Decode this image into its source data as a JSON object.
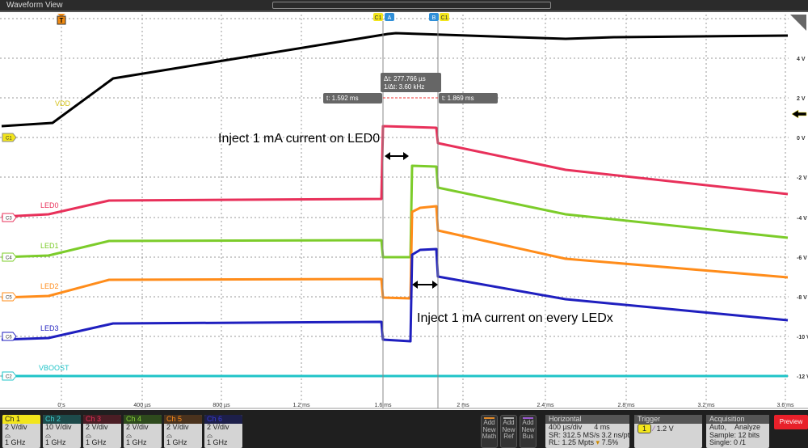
{
  "window": {
    "title": "Waveform View"
  },
  "y_axis_labels": [
    "4 V",
    "2 V",
    "0 V",
    "-2 V",
    "-4 V",
    "-6 V",
    "-8 V",
    "-10 V",
    "-12 V"
  ],
  "x_axis_labels": [
    "0 s",
    "400 µs",
    "800 µs",
    "1.2 ms",
    "1.6 ms",
    "2 ms",
    "2.4 ms",
    "2.8 ms",
    "3.2 ms",
    "3.6 ms"
  ],
  "traces": [
    {
      "label": "VDD",
      "marker": "C1",
      "color": "#000000",
      "label_color": "#d4c21a"
    },
    {
      "label": "LED0",
      "marker": "C3",
      "color": "#e8305a"
    },
    {
      "label": "LED1",
      "marker": "C4",
      "color": "#7ccc2a"
    },
    {
      "label": "LED2",
      "marker": "C5",
      "color": "#ff8c1a"
    },
    {
      "label": "LED3",
      "marker": "C6",
      "color": "#1f1fbf"
    },
    {
      "label": "VBOOST",
      "marker": "C2",
      "color": "#20c4c8"
    }
  ],
  "trigger_marker": "T",
  "cursors": {
    "a_label": "A",
    "b_label": "B",
    "source": "C1",
    "delta": "Δt: 277.766 µs",
    "inv_delta": "1/Δt: 3.60 kHz",
    "a_time": "t: 1.592 ms",
    "b_time": "t: 1.869 ms"
  },
  "annotations": {
    "led0": "Inject 1 mA current on LED0",
    "ledx": "Inject 1 mA current on every LEDx"
  },
  "channels": [
    {
      "name": "Ch 1",
      "scale": "2 V/div",
      "bw": "1 GHz",
      "color": "#f2e51c",
      "text": "#222"
    },
    {
      "name": "Ch 2",
      "scale": "10 V/div",
      "bw": "1 GHz",
      "color": "#1d4a4a",
      "text": "#3fd0d0"
    },
    {
      "name": "Ch 3",
      "scale": "2 V/div",
      "bw": "1 GHz",
      "color": "#4a1d24",
      "text": "#e8305a"
    },
    {
      "name": "Ch 4",
      "scale": "2 V/div",
      "bw": "1 GHz",
      "color": "#2e4a1d",
      "text": "#8ad03a"
    },
    {
      "name": "Ch 5",
      "scale": "2 V/div",
      "bw": "1 GHz",
      "color": "#4a321d",
      "text": "#ff8c1a"
    },
    {
      "name": "Ch 6",
      "scale": "2 V/div",
      "bw": "1 GHz",
      "color": "#1d1f4a",
      "text": "#3a3ad0"
    }
  ],
  "buttons": {
    "math": "Add New Math",
    "ref": "Add New Ref",
    "bus": "Add New Bus",
    "preview": "Preview"
  },
  "horizontal": {
    "title": "Horizontal",
    "scale": "400 µs/div",
    "duration": "4 ms",
    "sr": "SR: 312.5 MS/s",
    "pt": "3.2 ns/pt",
    "rl": "RL: 1.25 Mpts",
    "pos": "7.5%"
  },
  "trigger": {
    "title": "Trigger",
    "source": "1",
    "level": "1.2 V"
  },
  "acquisition": {
    "title": "Acquisition",
    "mode": "Auto,",
    "analyze": "Analyze",
    "sample": "Sample: 12 bits",
    "single": "Single: 0 /1"
  }
}
